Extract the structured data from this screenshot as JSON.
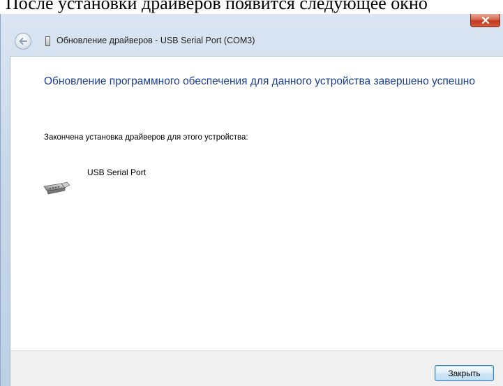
{
  "document": {
    "top_text": "После установки драйверов появится следующее окно"
  },
  "window": {
    "title": "Обновление драйверов - USB Serial Port (COM3)",
    "close_glyph": "x"
  },
  "content": {
    "heading": "Обновление программного обеспечения для данного устройства завершено успешно",
    "status": "Закончена установка драйверов для этого устройства:",
    "device_name": "USB Serial Port"
  },
  "footer": {
    "close_label": "Закрыть"
  },
  "icons": {
    "back": "back-arrow-icon",
    "device_small": "device-icon",
    "device": "serial-port-device-icon",
    "close": "close-x-icon"
  },
  "colors": {
    "heading": "#1a3d8f",
    "close_button_red": "#c0391f"
  }
}
